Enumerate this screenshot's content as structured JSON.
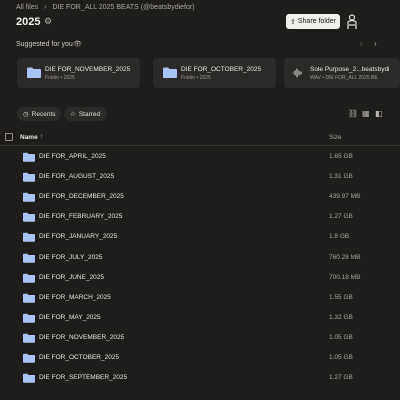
{
  "breadcrumb": {
    "root": "All files",
    "sep": "›",
    "current": "DIE FOR_ALL 2025 BEATS (@beatsbydiefor)"
  },
  "header": {
    "title": "2025",
    "share_label": "Share folder"
  },
  "suggested": {
    "label": "Suggested for you",
    "cards": [
      {
        "name": "DIE FOR_NOVEMBER_2025",
        "sub": "Folder • 2025",
        "type": "folder"
      },
      {
        "name": "DIE FOR_OCTOBER_2025",
        "sub": "Folder • 2025",
        "type": "folder"
      },
      {
        "name": "Sole Purpose_2...beatsbydi",
        "sub": "WAV • DIE FOR_ALL 2025 BE",
        "type": "audio"
      }
    ]
  },
  "filters": {
    "recents": "Recents",
    "starred": "Starred"
  },
  "table": {
    "col_name": "Name",
    "col_size": "Size",
    "sort_arrow": "↑",
    "rows": [
      {
        "name": "DIE FOR_APRIL_2025",
        "size": "1.65 GB"
      },
      {
        "name": "DIE FOR_AUGUST_2025",
        "size": "1.31 GB"
      },
      {
        "name": "DIE FOR_DECEMBER_2025",
        "size": "439.97 MB"
      },
      {
        "name": "DIE FOR_FEBRUARY_2025",
        "size": "1.27 GB"
      },
      {
        "name": "DIE FOR_JANUARY_2025",
        "size": "1.8 GB"
      },
      {
        "name": "DIE FOR_JULY_2025",
        "size": "760.28 MB"
      },
      {
        "name": "DIE FOR_JUNE_2025",
        "size": "700.18 MB"
      },
      {
        "name": "DIE FOR_MARCH_2025",
        "size": "1.55 GB"
      },
      {
        "name": "DIE FOR_MAY_2025",
        "size": "1.32 GB"
      },
      {
        "name": "DIE FOR_NOVEMBER_2025",
        "size": "1.05 GB"
      },
      {
        "name": "DIE FOR_OCTOBER_2025",
        "size": "1.05 GB"
      },
      {
        "name": "DIE FOR_SEPTEMBER_2025",
        "size": "1.27 GB"
      }
    ]
  },
  "colors": {
    "folder": "#a9c3f2",
    "background": "#1e1d1b",
    "card": "#2b2a28"
  }
}
